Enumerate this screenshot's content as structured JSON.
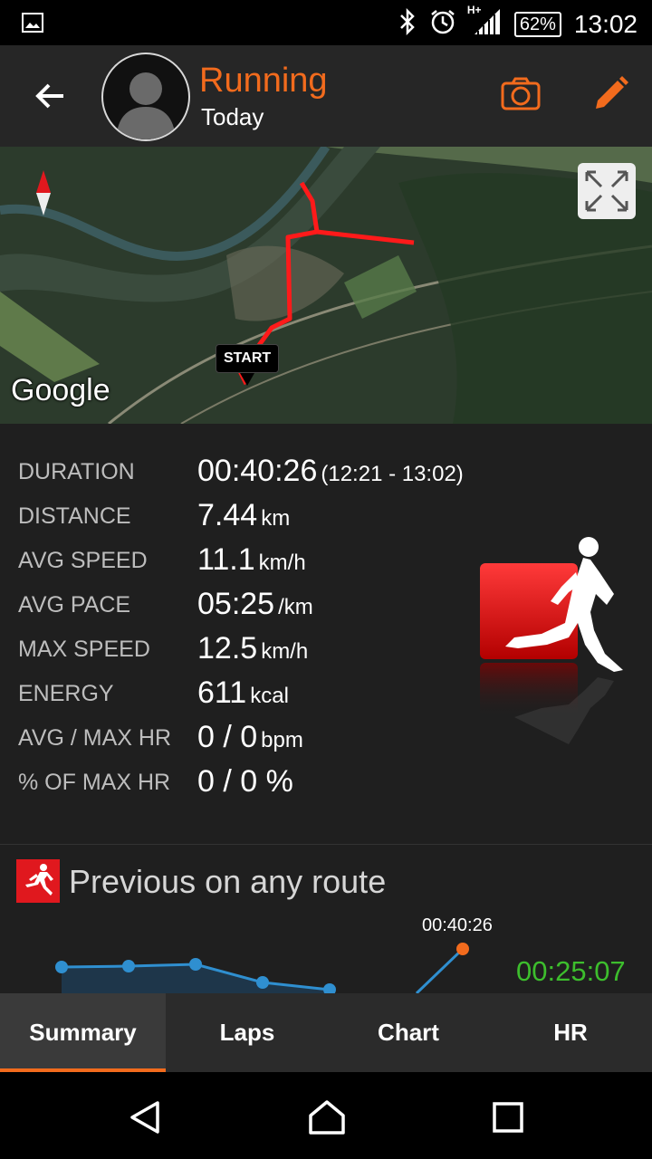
{
  "status_bar": {
    "battery": "62%",
    "network": "H+",
    "time": "13:02"
  },
  "header": {
    "title": "Running",
    "subtitle": "Today"
  },
  "map": {
    "start_label": "START",
    "attribution": "Google"
  },
  "stats": [
    {
      "label": "DURATION",
      "value": "00:40:26",
      "unit": "(12:21 - 13:02)"
    },
    {
      "label": "DISTANCE",
      "value": "7.44",
      "unit": "km"
    },
    {
      "label": "AVG SPEED",
      "value": "11.1",
      "unit": "km/h"
    },
    {
      "label": "AVG PACE",
      "value": "05:25",
      "unit": "/km"
    },
    {
      "label": "MAX SPEED",
      "value": "12.5",
      "unit": "km/h"
    },
    {
      "label": "ENERGY",
      "value": "611",
      "unit": "kcal"
    },
    {
      "label": "AVG / MAX HR",
      "value": "0 / 0",
      "unit": "bpm"
    },
    {
      "label": "% OF MAX HR",
      "value": "0 / 0 %",
      "unit": ""
    }
  ],
  "previous": {
    "title": "Previous on any route",
    "current_label": "00:40:26",
    "best_time": "00:25:07"
  },
  "tabs": [
    {
      "label": "Summary",
      "active": true
    },
    {
      "label": "Laps",
      "active": false
    },
    {
      "label": "Chart",
      "active": false
    },
    {
      "label": "HR",
      "active": false
    }
  ],
  "colors": {
    "accent": "#f26b1d",
    "route": "#ff1a1a",
    "best": "#3dbe2d",
    "chart_line": "#2f8fd0"
  },
  "icons": [
    "gallery-icon",
    "bluetooth-icon",
    "alarm-icon",
    "signal-icon",
    "battery-icon",
    "back-arrow-icon",
    "camera-icon",
    "edit-icon",
    "compass-icon",
    "expand-icon",
    "runner-icon",
    "back-nav-icon",
    "home-nav-icon",
    "recents-nav-icon"
  ]
}
